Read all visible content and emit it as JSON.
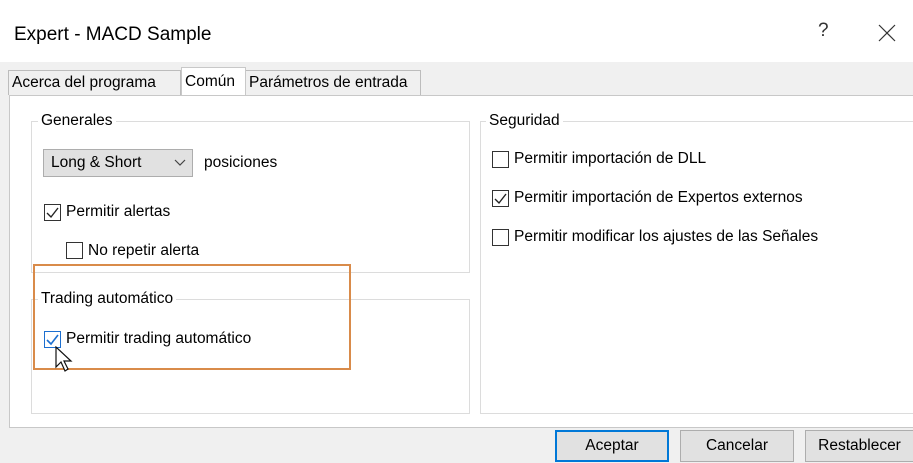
{
  "window": {
    "title": "Expert - MACD Sample",
    "help_label": "?"
  },
  "tabs": [
    {
      "label": "Acerca del programa"
    },
    {
      "label": "Común"
    },
    {
      "label": "Parámetros de entrada"
    }
  ],
  "generales": {
    "title": "Generales",
    "positions_select": {
      "value": "Long & Short"
    },
    "positions_label": "posiciones",
    "allow_alerts": {
      "label": "Permitir alertas",
      "checked": true
    },
    "no_repeat_alert": {
      "label": "No repetir alerta",
      "checked": false
    }
  },
  "trading": {
    "title": "Trading automático",
    "allow_auto_trading": {
      "label": "Permitir trading automático",
      "checked": true
    }
  },
  "seguridad": {
    "title": "Seguridad",
    "allow_dll": {
      "label": "Permitir importación de DLL",
      "checked": false
    },
    "allow_external_experts": {
      "label": "Permitir importación de Expertos externos",
      "checked": true
    },
    "allow_modify_signals": {
      "label": "Permitir modificar los ajustes de las Señales",
      "checked": false
    }
  },
  "buttons": {
    "ok": "Aceptar",
    "cancel": "Cancelar",
    "reset": "Restablecer"
  },
  "colors": {
    "highlight": "#d98b4a",
    "accent": "#0078d7",
    "checkmark_blue": "#1c6fd0"
  }
}
